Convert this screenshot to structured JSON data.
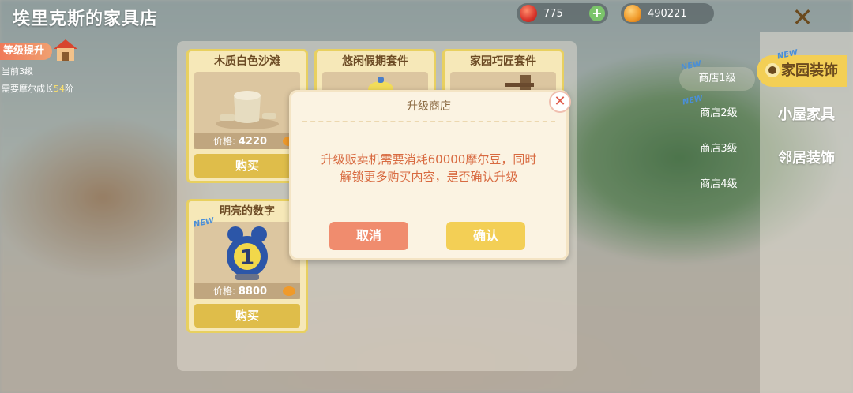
{
  "header": {
    "shop_title": "埃里克斯的家具店",
    "currency_red": "775",
    "currency_bean": "490221",
    "plus_label": "+",
    "close_label": "✕"
  },
  "level": {
    "tag": "等级提升",
    "current": "当前3级",
    "need_prefix": "需要摩尔成长",
    "need_value": "54",
    "need_suffix": "阶"
  },
  "cards": [
    {
      "name": "木质白色沙滩",
      "price_label": "价格:",
      "price": "4220",
      "buy": "购买",
      "new": ""
    },
    {
      "name": "悠闲假期套件",
      "price_label": "",
      "price": "",
      "buy": "",
      "new": ""
    },
    {
      "name": "家园巧匠套件",
      "price_label": "",
      "price": "",
      "buy": "",
      "new": ""
    },
    {
      "name": "明亮的数字",
      "price_label": "价格:",
      "price": "8800",
      "buy": "购买",
      "new": "NEW"
    }
  ],
  "categories": [
    {
      "label": "家园装饰",
      "new": "NEW"
    },
    {
      "label": "小屋家具",
      "new": ""
    },
    {
      "label": "邻居装饰",
      "new": ""
    }
  ],
  "shop_levels": [
    {
      "label": "商店1级",
      "new": "NEW"
    },
    {
      "label": "商店2级",
      "new": "NEW"
    },
    {
      "label": "商店3级",
      "new": ""
    },
    {
      "label": "商店4级",
      "new": ""
    }
  ],
  "dialog": {
    "title": "升级商店",
    "message_line1": "升级贩卖机需要消耗60000摩尔豆，同时",
    "message_line2": "解锁更多购买内容，是否确认升级",
    "cancel": "取消",
    "confirm": "确认",
    "close": "✕"
  },
  "colors": {
    "accent_yellow": "#f3cf55",
    "cancel_red": "#f08c6e",
    "message_orange": "#d86a40"
  }
}
